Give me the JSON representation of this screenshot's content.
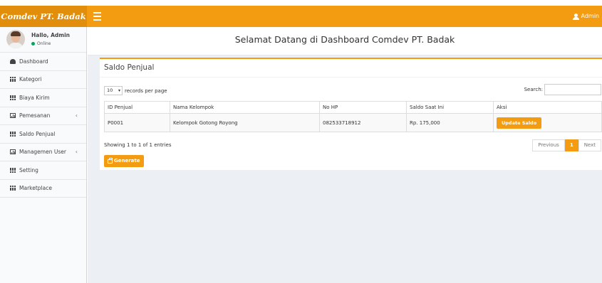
{
  "header": {
    "brand": "Comdev PT. Badak",
    "user_label": "Admin"
  },
  "sidebar": {
    "user_name": "Hallo, Admin",
    "user_status": "Online",
    "items": [
      {
        "label": "Dashboard",
        "icon": "dashboard-icon"
      },
      {
        "label": "Kategori",
        "icon": "grid-icon"
      },
      {
        "label": "Biaya Kirim",
        "icon": "grid-icon"
      },
      {
        "label": "Pemesanan",
        "icon": "chart-icon",
        "chevron": "‹"
      },
      {
        "label": "Saldo Penjual",
        "icon": "grid-icon"
      },
      {
        "label": "Managemen User",
        "icon": "chart-icon",
        "chevron": "‹"
      },
      {
        "label": "Setting",
        "icon": "grid-icon"
      },
      {
        "label": "Marketplace",
        "icon": "grid-icon"
      }
    ]
  },
  "main": {
    "page_title": "Selamat Datang di Dashboard Comdev PT. Badak",
    "box_title": "Saldo Penjual",
    "length_value": "10",
    "length_suffix": "records per page",
    "search_label": "Search:",
    "table": {
      "headers": [
        "ID Penjual",
        "Nama Kelompok",
        "No HP",
        "Saldo Saat Ini",
        "Aksi"
      ],
      "rows": [
        {
          "id": "P0001",
          "nama": "Kelompok Gotong Royong",
          "hp": "082533718912",
          "saldo": "Rp. 175,000",
          "aksi": "Update Saldo"
        }
      ]
    },
    "info_text": "Showing 1 to 1 of 1 entries",
    "pagination": {
      "previous": "Previous",
      "current": "1",
      "next": "Next"
    },
    "generate_label": "Generate"
  },
  "colors": {
    "accent": "#f39c12",
    "accent_dark": "#e08e0b",
    "online": "#00a65a",
    "content_bg": "#ecf0f5"
  }
}
